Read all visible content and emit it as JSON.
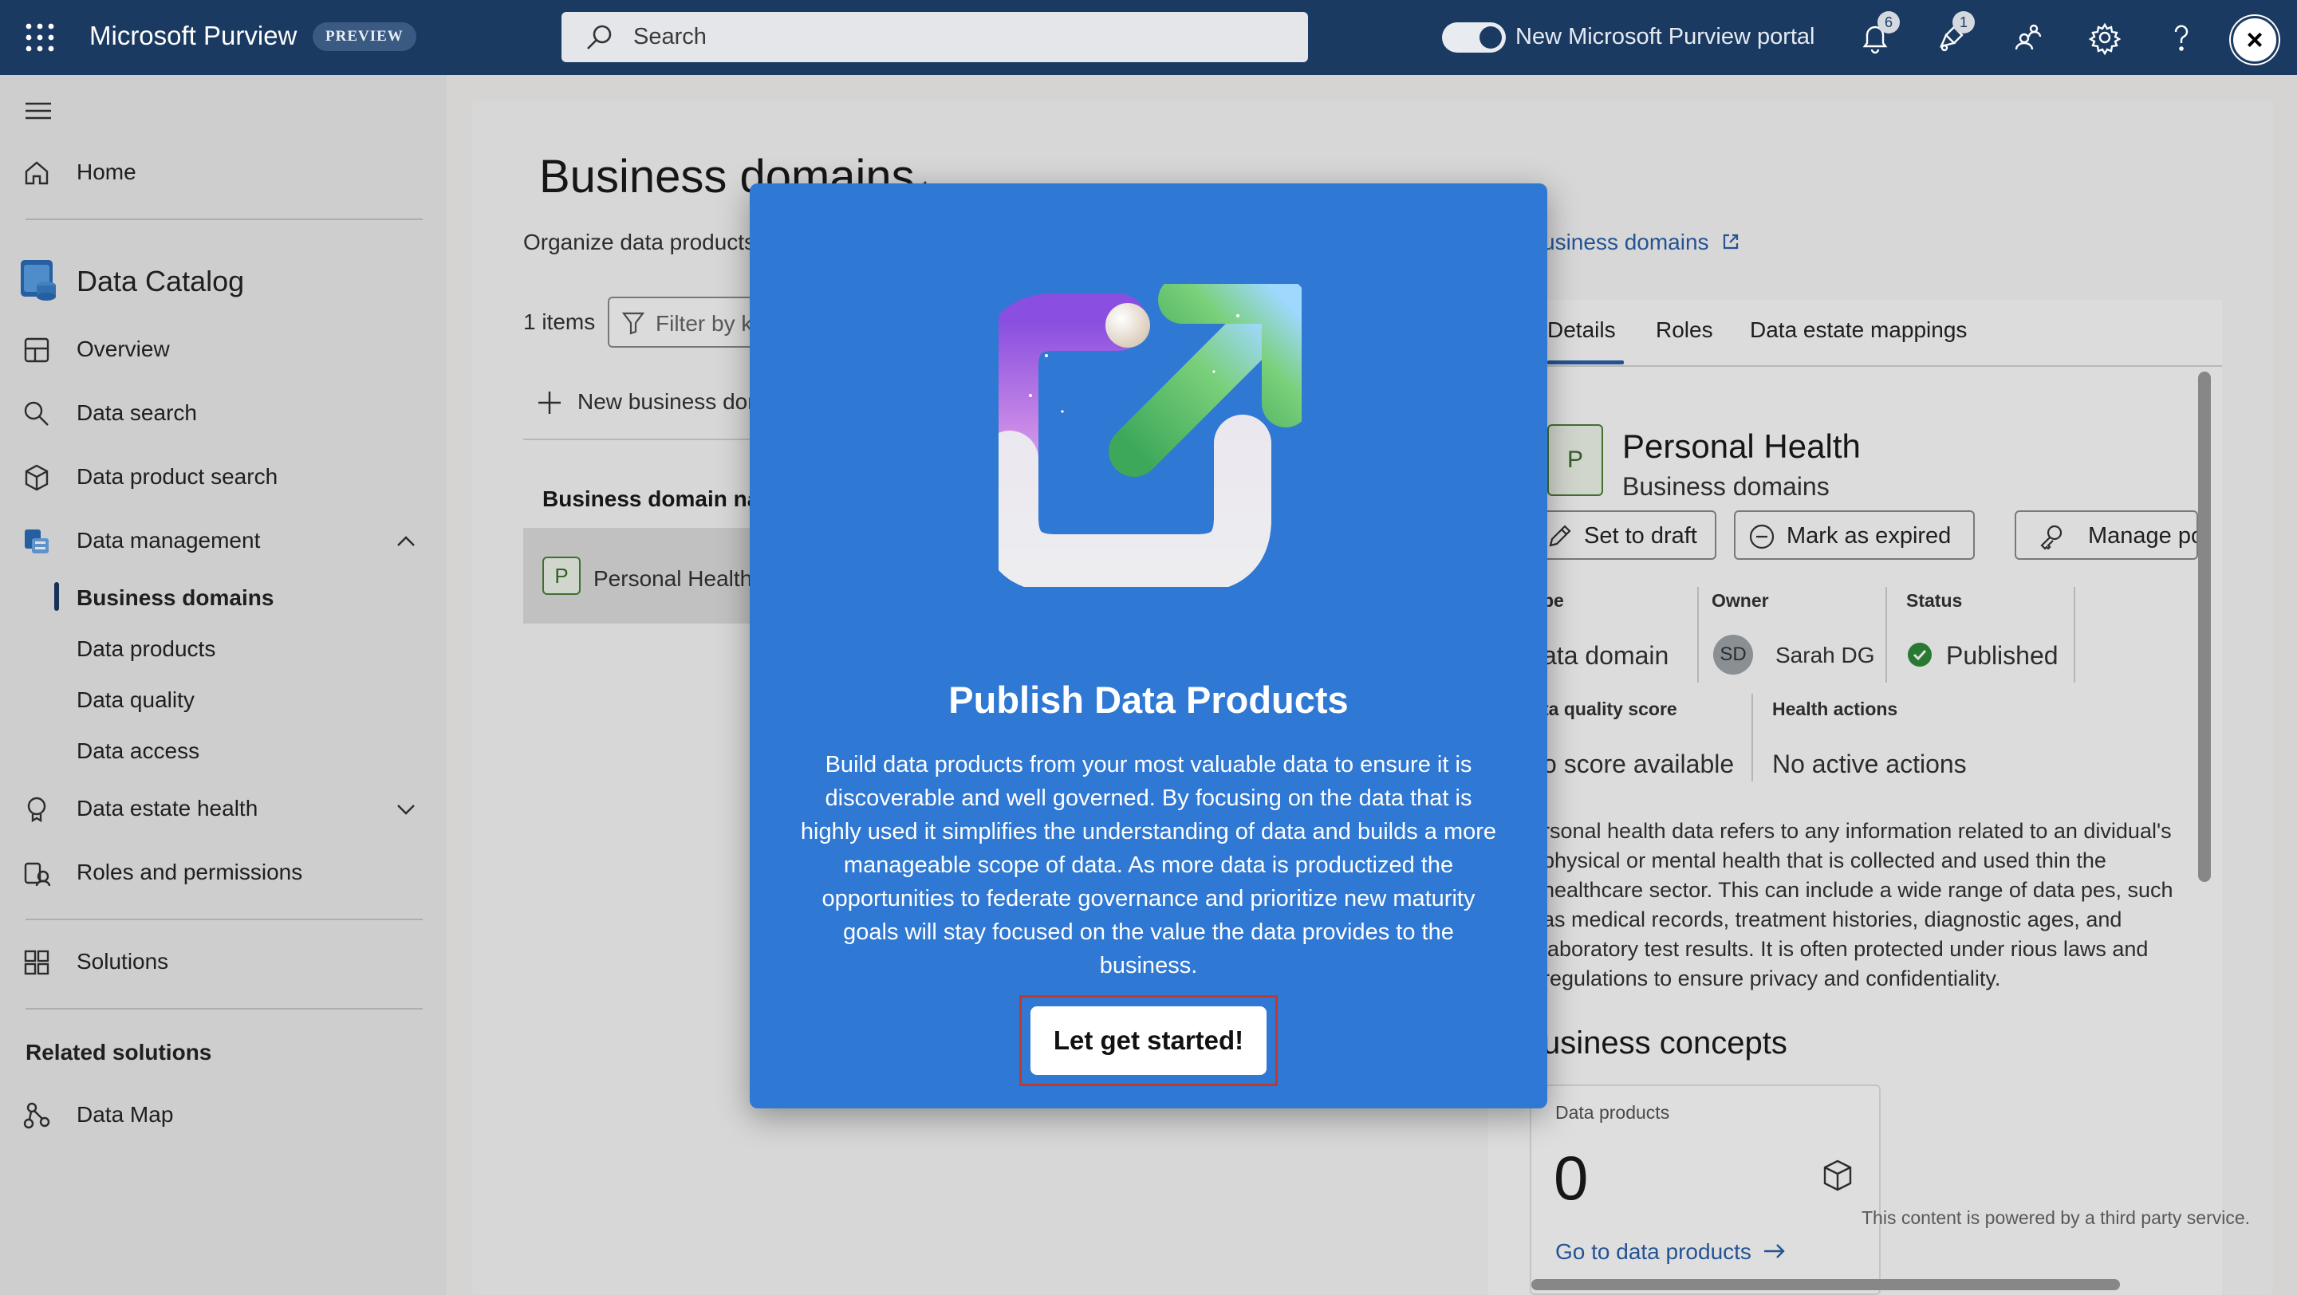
{
  "topbar": {
    "brand": "Microsoft Purview",
    "badge": "PREVIEW",
    "search_placeholder": "Search",
    "toggle_label": "New Microsoft Purview portal",
    "notifications_count": "6",
    "alerts_count": "1",
    "icons": [
      "app-launcher-icon",
      "search-icon",
      "bell-icon",
      "alert-icon",
      "people-icon",
      "gear-icon",
      "help-icon",
      "close-icon"
    ]
  },
  "sidebar": {
    "home": "Home",
    "catalog_title": "Data Catalog",
    "overview": "Overview",
    "data_search": "Data search",
    "data_product_search": "Data product search",
    "data_management": "Data management",
    "sub": [
      "Business domains",
      "Data products",
      "Data quality",
      "Data access"
    ],
    "data_estate_health": "Data estate health",
    "roles": "Roles and permissions",
    "solutions": "Solutions",
    "related_title": "Related solutions",
    "data_map": "Data Map"
  },
  "main": {
    "title": "Business domains",
    "description": "Organize data products",
    "learn_link": "usiness domains",
    "items_count": "1 items",
    "filter_placeholder": "Filter by k",
    "new_button": "New business dor",
    "column_header": "Business domain nar",
    "row": {
      "chip": "P",
      "name": "Personal Health"
    }
  },
  "details": {
    "tabs": [
      "Details",
      "Roles",
      "Data estate mappings"
    ],
    "chip": "P",
    "title": "Personal Health",
    "subtitle": "Business domains",
    "actions": [
      "Set to draft",
      "Mark as expired",
      "Manage pc"
    ],
    "type_label": "pe",
    "type_value": "ata domain",
    "owner_label": "Owner",
    "owner_initials": "SD",
    "owner_name": "Sarah DG",
    "status_label": "Status",
    "status_value": "Published",
    "quality_label": "ta quality score",
    "quality_value": "o score available",
    "health_label": "Health actions",
    "health_value": "No active actions",
    "description": "rsonal health data refers to any information related to an dividual's physical or mental health that is collected and used thin the healthcare sector. This can include a wide range of data pes, such as medical records, treatment histories, diagnostic ages, and laboratory test results. It is often protected under rious laws and regulations to ensure privacy and confidentiality.",
    "concepts_title": "usiness concepts",
    "data_products_label": "Data products",
    "data_products_count": "0",
    "go_link": "Go to data products",
    "powered_note": "This content is powered by a third party service."
  },
  "modal": {
    "title": "Publish Data Products",
    "body": "Build data products from your most valuable data to ensure it is discoverable and well governed.  By focusing on the data that is highly used it simplifies the understanding of data and builds a more manageable scope of data.  As more data is productized the opportunities to federate governance and prioritize new maturity goals will stay focused on the value the data provides to the business.",
    "cta": "Let get started!"
  },
  "colors": {
    "topbar": "#1b3a62",
    "modal": "#2f78d3",
    "cta_outline": "#c0392b",
    "link": "#2a5fa8",
    "published": "#2e8b3a"
  }
}
